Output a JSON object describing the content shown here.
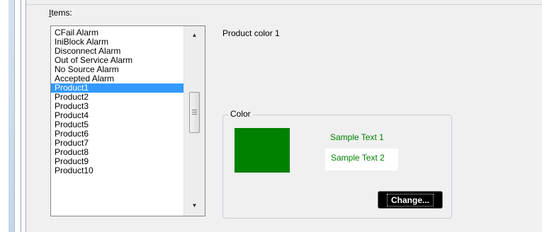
{
  "items_label": "Items:",
  "items_label_accel": "I",
  "items_label_rest": "tems:",
  "list": {
    "items": [
      "CFail Alarm",
      "IniBlock Alarm",
      "Disconnect Alarm",
      "Out of Service Alarm",
      "No Source Alarm",
      "Accepted Alarm",
      "Product1",
      "Product2",
      "Product3",
      "Product4",
      "Product5",
      "Product6",
      "Product7",
      "Product8",
      "Product9",
      "Product10"
    ],
    "selected": "Product1"
  },
  "product_caption": "Product color 1",
  "color_group": {
    "title": "Color",
    "sample_text_1": "Sample Text 1",
    "sample_text_2": "Sample Text 2",
    "swatch_color": "#008000",
    "change_label": "Change..."
  }
}
